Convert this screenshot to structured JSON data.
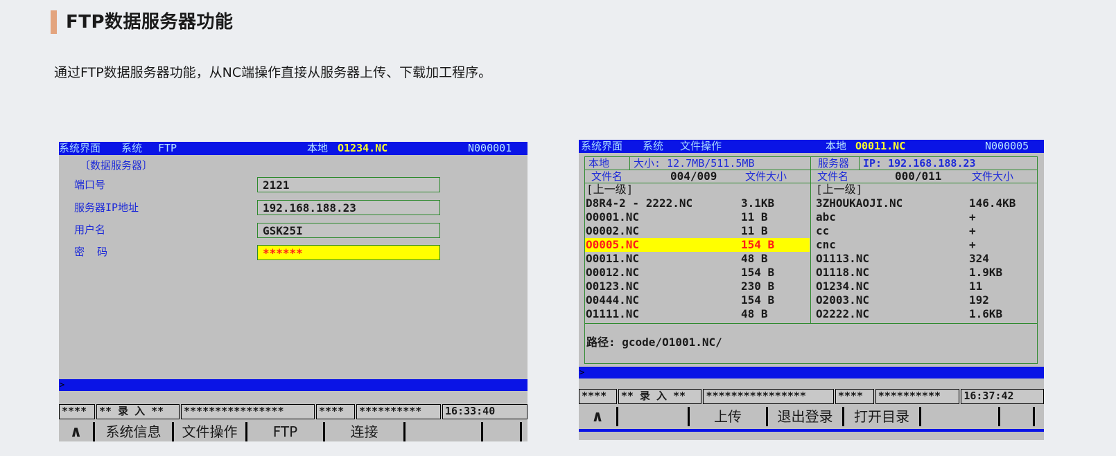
{
  "page": {
    "title": "FTP数据服务器功能",
    "description": "通过FTP数据服务器功能，从NC端操作直接从服务器上传、下载加工程序。"
  },
  "screen1": {
    "titlebar": {
      "crumb1": "系统界面",
      "crumb2": "系统",
      "crumb3": "FTP",
      "local_label": "本地",
      "program": "O1234.NC",
      "seq": "N000001"
    },
    "section_title": "〔数据服务器〕",
    "fields": {
      "port": {
        "label": "端口号",
        "value": "2121"
      },
      "ip": {
        "label": "服务器IP地址",
        "value": "192.168.188.23"
      },
      "user": {
        "label": "用户名",
        "value": "GSK25I"
      },
      "password": {
        "label": "密  码",
        "value": "******"
      }
    },
    "cmd_prompt": ">",
    "status": [
      "****",
      "** 录 入 **",
      "****************",
      "****",
      "**********",
      "16:33:40"
    ],
    "softkeys": [
      "∧",
      "系统信息",
      "文件操作",
      "FTP",
      "连接",
      "",
      ""
    ]
  },
  "screen2": {
    "titlebar": {
      "crumb1": "系统界面",
      "crumb2": "系统",
      "crumb3": "文件操作",
      "local_label": "本地",
      "program": "O0011.NC",
      "seq": "N000005"
    },
    "local": {
      "title": "本地",
      "size": "大小: 12.7MB/511.5MB",
      "col_name": "文件名",
      "count": "004/009",
      "col_size": "文件大小",
      "parent": "[上一级]",
      "files": [
        {
          "name": "D8R4-2 - 2222.NC",
          "size": "3.1KB"
        },
        {
          "name": "O0001.NC",
          "size": "11 B"
        },
        {
          "name": "O0002.NC",
          "size": "11 B"
        },
        {
          "name": "O0005.NC",
          "size": "154 B"
        },
        {
          "name": "O0011.NC",
          "size": "48 B"
        },
        {
          "name": "O0012.NC",
          "size": "154 B"
        },
        {
          "name": "O0123.NC",
          "size": "230 B"
        },
        {
          "name": "O0444.NC",
          "size": "154 B"
        },
        {
          "name": "O1111.NC",
          "size": "48 B"
        }
      ],
      "selected_index": 3
    },
    "server": {
      "title": "服务器",
      "ip": "IP:  192.168.188.23",
      "col_name": "文件名",
      "count": "000/011",
      "col_size": "文件大小",
      "parent": "[上一级]",
      "files": [
        {
          "name": "3ZHOUKAOJI.NC",
          "size": "146.4KB"
        },
        {
          "name": "abc",
          "size": "+"
        },
        {
          "name": "cc",
          "size": "+"
        },
        {
          "name": "cnc",
          "size": "+"
        },
        {
          "name": "O1113.NC",
          "size": "324"
        },
        {
          "name": "O1118.NC",
          "size": "1.9KB"
        },
        {
          "name": "O1234.NC",
          "size": "11"
        },
        {
          "name": "O2003.NC",
          "size": "192"
        },
        {
          "name": "O2222.NC",
          "size": "1.6KB"
        }
      ]
    },
    "path": "路径: gcode/O1001.NC/",
    "cmd_prompt": ">",
    "status": [
      "****",
      "** 录 入 **",
      "****************",
      "****",
      "**********",
      "16:37:42"
    ],
    "softkeys": [
      "∧",
      "",
      "上传",
      "退出登录",
      "打开目录",
      "",
      ""
    ]
  },
  "colors": {
    "title_bar": "#0a14e6",
    "screen_bg": "#c0c0c0",
    "highlight": "#ffff00",
    "accent": "#e3a47e"
  }
}
